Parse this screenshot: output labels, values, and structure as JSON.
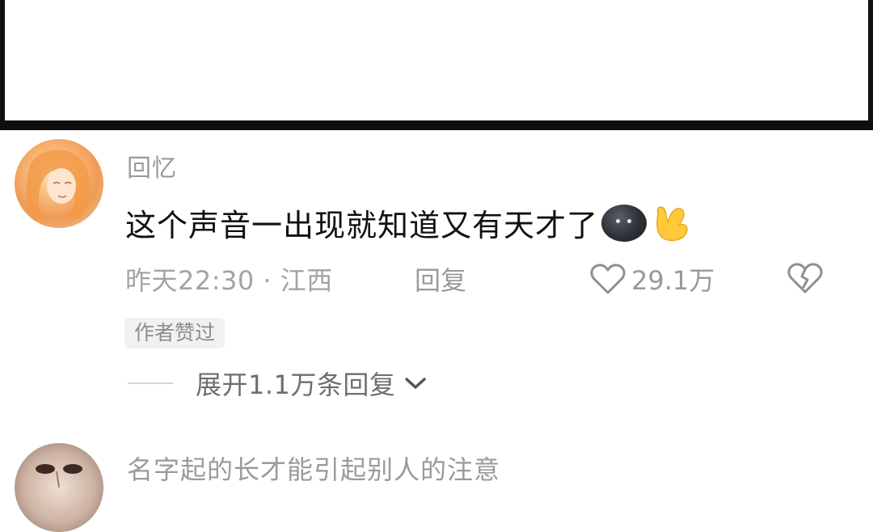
{
  "comments": [
    {
      "username": "回忆",
      "text": "这个声音一出现就知道又有天才了",
      "time_location": "昨天22:30 · 江西",
      "reply_label": "回复",
      "like_count": "29.1万",
      "author_badge": "作者赞过",
      "expand_replies_label": "展开1.1万条回复",
      "emojis": [
        "dark-face-emoji",
        "yellow-hand-emoji"
      ]
    },
    {
      "username": "名字起的长才能引起别人的注意"
    }
  ],
  "icons": {
    "like": "heart-outline-icon",
    "dislike": "broken-heart-icon",
    "expand": "chevron-down-icon"
  },
  "colors": {
    "username": "#9a9a9a",
    "comment_text": "#111111",
    "meta": "#a3a3a3",
    "badge_bg": "#f1f1f1"
  }
}
